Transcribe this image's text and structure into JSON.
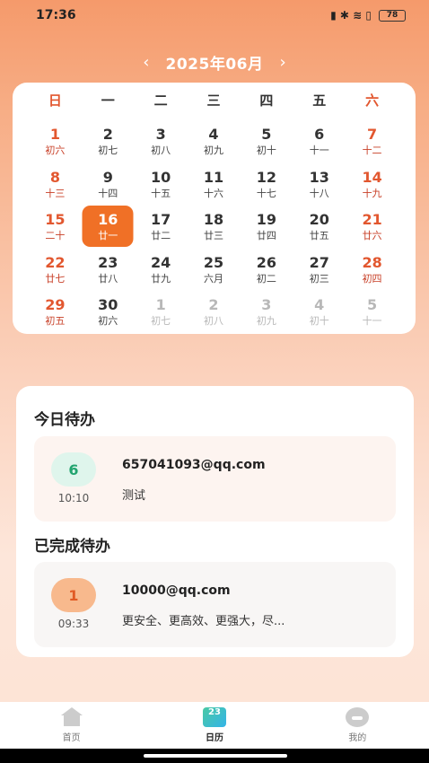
{
  "status_bar": {
    "time": "17:36",
    "icons": "▮ ✱ ≋ ▯",
    "battery": "78"
  },
  "month_nav": {
    "prev": "‹",
    "title": "2025年06月",
    "next": "›"
  },
  "calendar": {
    "weekdays": [
      "日",
      "一",
      "二",
      "三",
      "四",
      "五",
      "六"
    ],
    "days": [
      {
        "num": "1",
        "lunar": "初六"
      },
      {
        "num": "2",
        "lunar": "初七"
      },
      {
        "num": "3",
        "lunar": "初八"
      },
      {
        "num": "4",
        "lunar": "初九"
      },
      {
        "num": "5",
        "lunar": "初十"
      },
      {
        "num": "6",
        "lunar": "十一"
      },
      {
        "num": "7",
        "lunar": "十二"
      },
      {
        "num": "8",
        "lunar": "十三"
      },
      {
        "num": "9",
        "lunar": "十四"
      },
      {
        "num": "10",
        "lunar": "十五"
      },
      {
        "num": "11",
        "lunar": "十六"
      },
      {
        "num": "12",
        "lunar": "十七"
      },
      {
        "num": "13",
        "lunar": "十八"
      },
      {
        "num": "14",
        "lunar": "十九"
      },
      {
        "num": "15",
        "lunar": "二十"
      },
      {
        "num": "16",
        "lunar": "廿一"
      },
      {
        "num": "17",
        "lunar": "廿二"
      },
      {
        "num": "18",
        "lunar": "廿三"
      },
      {
        "num": "19",
        "lunar": "廿四"
      },
      {
        "num": "20",
        "lunar": "廿五"
      },
      {
        "num": "21",
        "lunar": "廿六"
      },
      {
        "num": "22",
        "lunar": "廿七"
      },
      {
        "num": "23",
        "lunar": "廿八"
      },
      {
        "num": "24",
        "lunar": "廿九"
      },
      {
        "num": "25",
        "lunar": "六月"
      },
      {
        "num": "26",
        "lunar": "初二"
      },
      {
        "num": "27",
        "lunar": "初三"
      },
      {
        "num": "28",
        "lunar": "初四"
      },
      {
        "num": "29",
        "lunar": "初五"
      },
      {
        "num": "30",
        "lunar": "初六"
      },
      {
        "num": "1",
        "lunar": "初七"
      },
      {
        "num": "2",
        "lunar": "初八"
      },
      {
        "num": "3",
        "lunar": "初九"
      },
      {
        "num": "4",
        "lunar": "初十"
      },
      {
        "num": "5",
        "lunar": "十一"
      }
    ]
  },
  "today_todo": {
    "title": "今日待办",
    "item": {
      "badge": "6",
      "time": "10:10",
      "email": "657041093@qq.com",
      "desc": "测试"
    }
  },
  "done_todo": {
    "title": "已完成待办",
    "item": {
      "badge": "1",
      "time": "09:33",
      "email": "10000@qq.com",
      "desc": "更安全、更高效、更强大，尽..."
    }
  },
  "tabs": {
    "home": "首页",
    "calendar": "日历",
    "calendar_icon_text": "23",
    "mine": "我的"
  },
  "colors": {
    "accent": "#f07026",
    "weekend": "#e2572f",
    "badge_green": "#22a46f"
  }
}
